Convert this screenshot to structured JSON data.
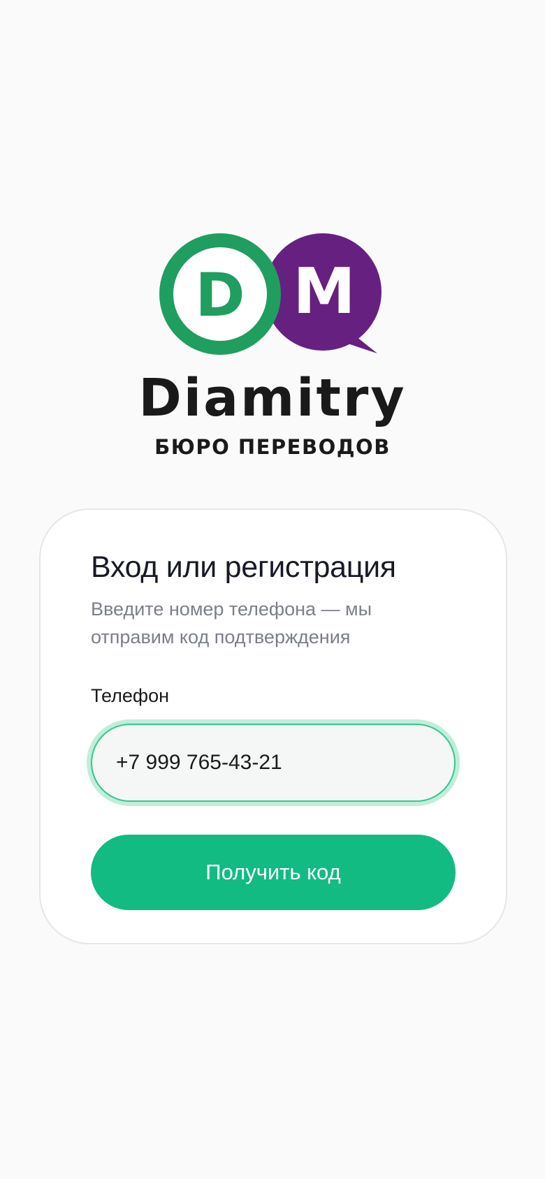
{
  "brand": {
    "logo_letter_left": "D",
    "logo_letter_right": "M",
    "name": "Diamitry",
    "subtitle": "БЮРО ПЕРЕВОДОВ",
    "colors": {
      "green": "#1f9e5f",
      "purple": "#66207f"
    }
  },
  "auth": {
    "title": "Вход или регистрация",
    "description": "Введите номер телефона — мы отправим код подтверждения",
    "phone_label": "Телефон",
    "phone_value": "+7 999 765-43-21",
    "submit_label": "Получить код"
  },
  "colors": {
    "background": "#fafafa",
    "accent": "#12bb82",
    "input_focus_ring": "#bfeeda"
  }
}
